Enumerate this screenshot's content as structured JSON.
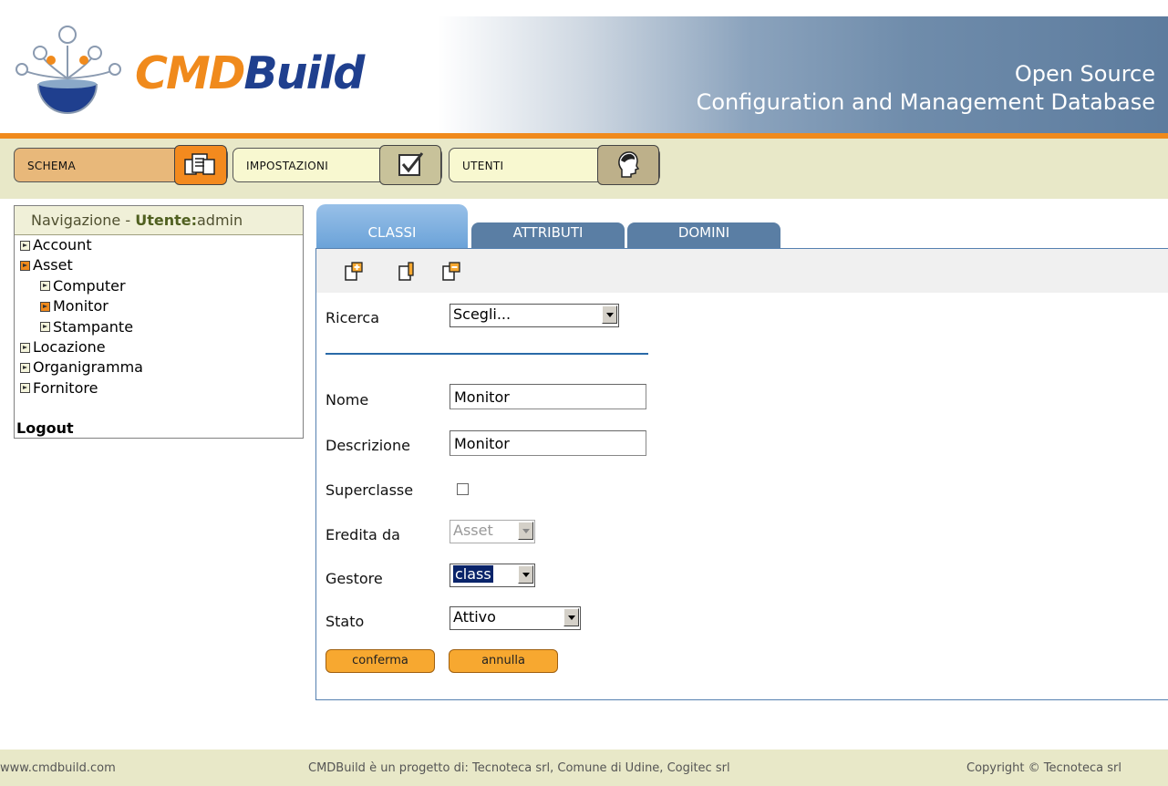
{
  "header": {
    "logo": {
      "part1": "CMD",
      "part2": "Build"
    },
    "tagline_line1": "Open Source",
    "tagline_line2": "Configuration and Management Database"
  },
  "toolbar": {
    "schema_label": "SCHEMA",
    "impostazioni_label": "IMPOSTAZIONI",
    "utenti_label": "UTENTI",
    "schema_icon": "schema-icon",
    "impostazioni_icon": "checklist-icon",
    "utenti_icon": "user-head-icon"
  },
  "nav": {
    "title": "Navigazione - ",
    "user_label": "Utente:",
    "user_name": "admin",
    "items": [
      {
        "label": "Account",
        "level": 0,
        "active": false
      },
      {
        "label": "Asset",
        "level": 0,
        "active": true
      },
      {
        "label": "Computer",
        "level": 1,
        "active": false
      },
      {
        "label": "Monitor",
        "level": 1,
        "active": true
      },
      {
        "label": "Stampante",
        "level": 1,
        "active": false
      },
      {
        "label": "Locazione",
        "level": 0,
        "active": false
      },
      {
        "label": "Organigramma",
        "level": 0,
        "active": false
      },
      {
        "label": "Fornitore",
        "level": 0,
        "active": false
      }
    ],
    "logout": "Logout"
  },
  "tabs": {
    "classi": "CLASSI",
    "attributi": "ATTRIBUTI",
    "domini": "DOMINI"
  },
  "form": {
    "ricerca_label": "Ricerca",
    "ricerca_value": "Scegli...",
    "nome_label": "Nome",
    "nome_value": "Monitor",
    "descrizione_label": "Descrizione",
    "descrizione_value": "Monitor",
    "superclasse_label": "Superclasse",
    "superclasse_checked": false,
    "eredita_label": "Eredita da",
    "eredita_value": "Asset",
    "gestore_label": "Gestore",
    "gestore_value": "class",
    "stato_label": "Stato",
    "stato_value": "Attivo",
    "conferma": "conferma",
    "annulla": "annulla"
  },
  "footer": {
    "site": "www.cmdbuild.com",
    "project": "CMDBuild è un progetto di: Tecnoteca srl, Comune di Udine, Cogitec srl",
    "copyright": "Copyright © Tecnoteca srl"
  },
  "colors": {
    "accent_orange": "#f08a1c",
    "brand_blue": "#1f3f8e",
    "tab_active": "#6aa2d8",
    "tab_inactive": "#5a7ea4"
  }
}
